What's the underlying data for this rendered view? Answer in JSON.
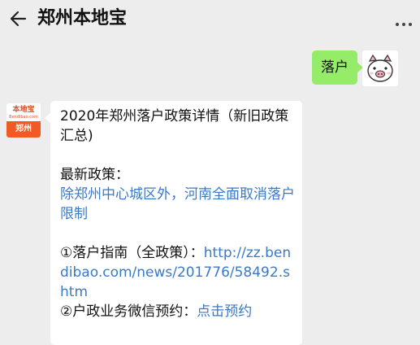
{
  "header": {
    "title": "郑州本地宝"
  },
  "icons": {
    "back": "arrow-left-icon",
    "more": "more-dots-icon",
    "user_avatar": "pig-avatar",
    "bot_avatar": "bendibao-logo"
  },
  "colors": {
    "background": "#ededed",
    "outgoing_bubble": "#95ec69",
    "incoming_bubble": "#ffffff",
    "link": "#3a79c9",
    "logo_orange": "#f15a24"
  },
  "messages": {
    "outgoing": {
      "text": "落户"
    },
    "bot_avatar": {
      "brand": "本地宝",
      "site": "Bendibao.com",
      "city": "郑州"
    },
    "incoming": {
      "title": "2020年郑州落户政策详情（新旧政策汇总)",
      "latest_label": "最新政策：",
      "latest_link": "除郑州中心城区外，河南全面取消落户限制",
      "item1_label": "①落户指南（全政策）：",
      "item1_link": "http://zz.bendibao.com/news/201776/58492.shtm",
      "item2_label": "②户政业务微信预约：",
      "item2_link": "点击预约"
    }
  }
}
